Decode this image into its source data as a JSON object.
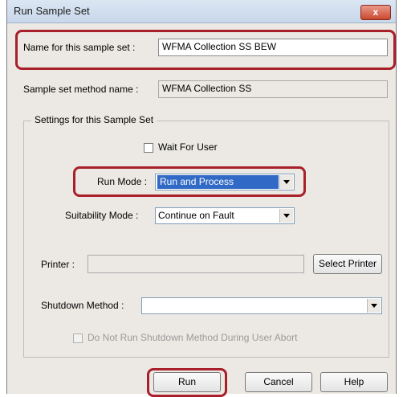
{
  "window": {
    "title": "Run Sample Set",
    "close_glyph": "x"
  },
  "sample_set_name": {
    "label": "Name for this sample set :",
    "value": "WFMA Collection SS BEW"
  },
  "method_name": {
    "label": "Sample set method name :",
    "value": "WFMA Collection SS"
  },
  "settings": {
    "group_title": "Settings for this Sample Set",
    "wait_for_user": {
      "label": "Wait For User",
      "checked": false
    },
    "run_mode": {
      "label": "Run Mode :",
      "value": "Run and Process"
    },
    "suitability_mode": {
      "label": "Suitability Mode :",
      "value": "Continue on Fault"
    },
    "printer": {
      "label": "Printer :",
      "value": "",
      "select_button": "Select Printer"
    },
    "shutdown_method": {
      "label": "Shutdown Method :",
      "value": ""
    },
    "no_shutdown_on_abort": {
      "label": "Do Not Run Shutdown Method During User Abort",
      "checked": false,
      "enabled": false
    }
  },
  "buttons": {
    "run": "Run",
    "cancel": "Cancel",
    "help": "Help"
  },
  "colors": {
    "highlight_outline": "#a8202a",
    "selection": "#3169c6",
    "dialog_bg": "#ece9e4"
  }
}
